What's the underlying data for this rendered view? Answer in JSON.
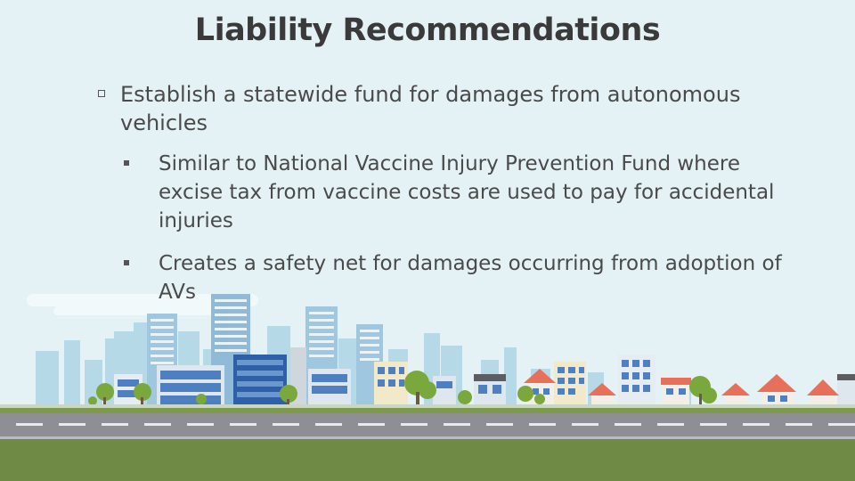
{
  "slide": {
    "title": "Liability Recommendations",
    "bullets": [
      {
        "text": "Establish a statewide fund for damages from autonomous vehicles",
        "sub_bullets": [
          "Similar to National Vaccine Injury Prevention Fund where excise tax from vaccine costs are used to pay for accidental injuries",
          "Creates a safety net for damages occurring from adoption of AVs"
        ]
      }
    ]
  },
  "colors": {
    "background": "#e4f2f5",
    "title_text": "#3a3a3a",
    "body_text": "#4a4a4a",
    "grass": "#6e8a44",
    "road": "#8d8f94",
    "building_blue": "#4d7fc1",
    "roof_red": "#e8705a",
    "tree_green": "#7aa83c"
  },
  "illustration": {
    "icon": "city-skyline-illustration"
  }
}
